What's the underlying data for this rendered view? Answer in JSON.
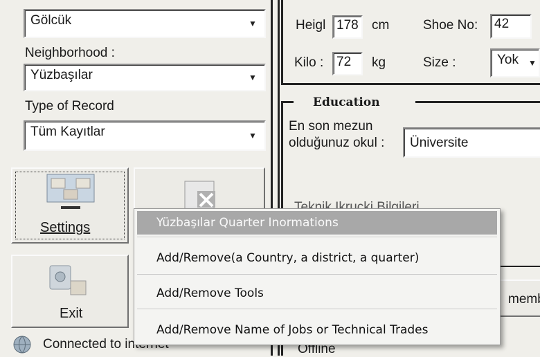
{
  "left_panel": {
    "district_combo": "Gölcük",
    "neighborhood_label": "Neighborhood :",
    "neighborhood_combo": "Yüzbaşılar",
    "record_type_label": "Type of Record",
    "record_type_combo": "Tüm Kayıtlar",
    "settings_button": "Settings",
    "exit_button": "Exit",
    "status_text": "Connected to internet"
  },
  "personal": {
    "height_label": "Heigl",
    "height_value": "178",
    "height_unit": "cm",
    "shoe_label": "Shoe No:",
    "shoe_value": "42",
    "weight_label": "Kilo :",
    "weight_value": "72",
    "weight_unit": "kg",
    "size_label": "Size :",
    "size_value": "Yok"
  },
  "education": {
    "title": "Education",
    "school_label_line1": "En son mezun",
    "school_label_line2": "olduğunuz okul :",
    "school_value": "Üniversite",
    "hidden_label": "Teknik Ikrucki Bilgileri",
    "member_button": "memb",
    "offline_text": "Offline"
  },
  "context_menu": {
    "items": [
      {
        "label": "Yüzbaşılar Quarter Inormations",
        "disabled": true
      },
      {
        "label": "Add/Remove(a Country, a district, a quarter)",
        "disabled": false
      },
      {
        "label": "Add/Remove Tools",
        "disabled": false
      },
      {
        "label": "Add/Remove Name of Jobs or Technical Trades",
        "disabled": false
      }
    ]
  },
  "icons": {
    "combo_arrow": "triangle-down",
    "settings": "settings-monitor-icon",
    "exit": "exit-icon",
    "globe": "globe-icon"
  }
}
